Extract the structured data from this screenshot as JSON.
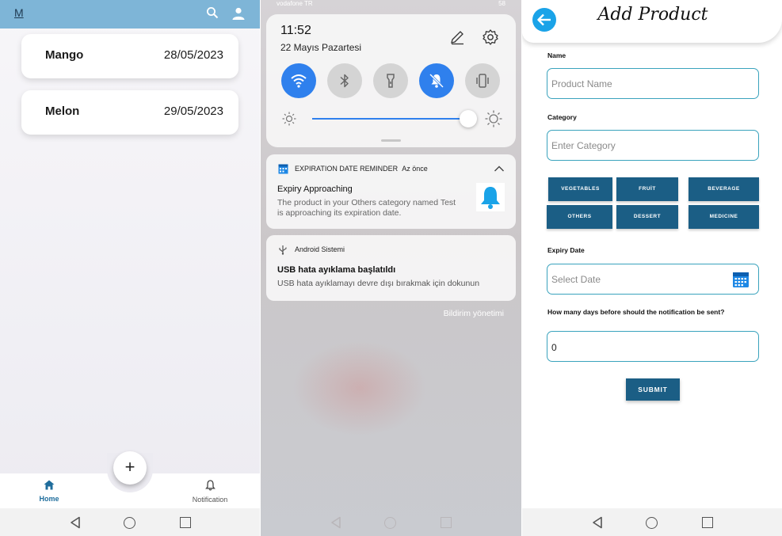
{
  "screen1": {
    "logo": "M",
    "products": [
      {
        "name": "Mango",
        "date": "28/05/2023"
      },
      {
        "name": "Melon",
        "date": "29/05/2023"
      }
    ],
    "fab_label": "+",
    "nav": {
      "home": "Home",
      "notification": "Notification"
    },
    "colors": {
      "appbar": "#7eb5d7",
      "accent": "#1f6d9c"
    }
  },
  "screen2": {
    "status_left": "vodafone TR",
    "status_right": "58",
    "time": "11:52",
    "date": "22 Mayıs Pazartesi",
    "notifications": [
      {
        "app": "EXPIRATION DATE REMINDER",
        "when": "Az önce",
        "title": "Expiry Approaching",
        "body": "The product in your Others category named Test is approaching its expiration date."
      },
      {
        "app": "Android Sistemi",
        "title": "USB hata ayıklama başlatıldı",
        "body": "USB hata ayıklamayı devre dışı bırakmak için dokunun"
      }
    ],
    "manage_label": "Bildirim yönetimi",
    "colors": {
      "toggle_on": "#2f80ed"
    }
  },
  "screen3": {
    "title": "Add Product",
    "name_label": "Name",
    "name_placeholder": "Product Name",
    "category_label": "Category",
    "category_placeholder": "Enter Category",
    "categories": [
      "VEGETABLES",
      "FRUİT",
      "BEVERAGE",
      "OTHERS",
      "DESSERT",
      "MEDICINE"
    ],
    "expiry_label": "Expiry Date",
    "expiry_placeholder": "Select Date",
    "days_label": "How many days before should the notification be sent?",
    "days_value": "0",
    "submit_label": "SUBMIT",
    "colors": {
      "button": "#1b5e85",
      "input_border": "#3aa3bd",
      "back": "#1aa3e8"
    }
  }
}
